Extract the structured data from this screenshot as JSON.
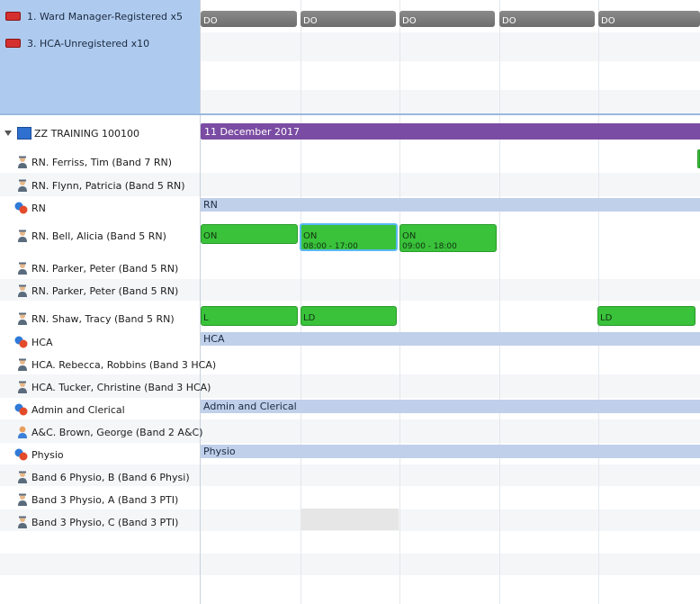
{
  "requirements": [
    {
      "label": "1. Ward Manager-Registered x5",
      "color": "#d43030"
    },
    {
      "label": "3. HCA-Unregistered x10",
      "color": "#d43030"
    }
  ],
  "do_blocks": [
    "DO",
    "DO",
    "DO",
    "DO",
    "DO"
  ],
  "unit": {
    "label": "ZZ TRAINING 100100",
    "date": "11 December 2017"
  },
  "rows": [
    {
      "label": "RN. Ferriss, Tim (Band 7 RN)",
      "type": "person"
    },
    {
      "label": "RN. Flynn, Patricia (Band 5 RN)",
      "type": "person"
    },
    {
      "label": "RN",
      "type": "group",
      "bar": "RN"
    },
    {
      "label": "RN. Bell, Alicia (Band 5 RN)",
      "type": "person"
    },
    {
      "label": "RN. Parker, Peter (Band 5 RN)",
      "type": "person"
    },
    {
      "label": "RN. Parker, Peter (Band 5 RN)",
      "type": "person"
    },
    {
      "label": "RN. Shaw, Tracy (Band 5 RN)",
      "type": "person"
    },
    {
      "label": "HCA",
      "type": "group",
      "bar": "HCA"
    },
    {
      "label": "HCA. Rebecca, Robbins (Band 3 HCA)",
      "type": "person"
    },
    {
      "label": "HCA. Tucker, Christine (Band 3 HCA)",
      "type": "person"
    },
    {
      "label": "Admin and Clerical",
      "type": "group",
      "bar": "Admin and Clerical"
    },
    {
      "label": "A&C. Brown, George (Band 2 A&C)",
      "type": "person-plain"
    },
    {
      "label": "Physio",
      "type": "group",
      "bar": "Physio"
    },
    {
      "label": "Band 6 Physio, B (Band 6 Physi)",
      "type": "person"
    },
    {
      "label": "Band 3 Physio, A (Band 3 PTI)",
      "type": "person"
    },
    {
      "label": "Band 3 Physio, C (Band 3 PTI)",
      "type": "person"
    }
  ],
  "shifts": {
    "bell": [
      {
        "code": "ON",
        "time": ""
      },
      {
        "code": "ON",
        "time": "08:00 - 17:00"
      },
      {
        "code": "ON",
        "time": "09:00 - 18:00"
      }
    ],
    "shaw": [
      {
        "code": "L"
      },
      {
        "code": "LD"
      },
      {
        "code": "LD"
      }
    ]
  },
  "colors": {
    "requirement_panel": "#aecbef",
    "do_block": "#7a7a7a",
    "date_bar": "#7b4ca3",
    "group_bar": "#c0d0ea",
    "shift_green": "#39c23a",
    "selected_outline": "#5bb8f2"
  }
}
